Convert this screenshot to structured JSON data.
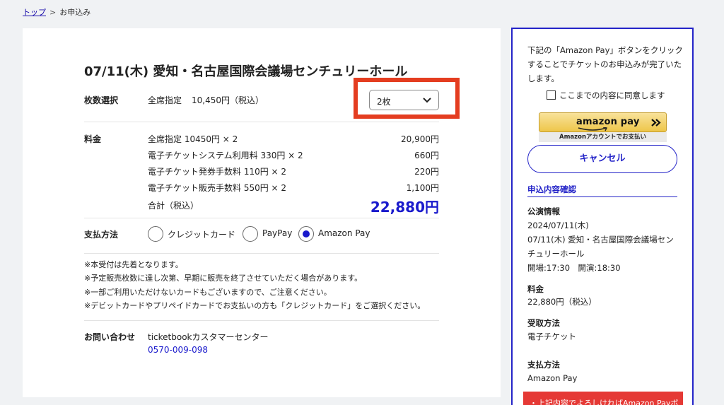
{
  "breadcrumb": {
    "home": "トップ",
    "separator": ">",
    "current": "お申込み"
  },
  "event": {
    "title": "07/11(木) 愛知・名古屋国際会議場センチュリーホール"
  },
  "quantity": {
    "label": "枚数選択",
    "seat_type": "全席指定",
    "unit_price": "10,450円（税込）",
    "selected": "2枚",
    "highlight_color": "#e43d20"
  },
  "fees": {
    "label": "料金",
    "lines": [
      {
        "desc": "全席指定 10450円 × 2",
        "amount": "20,900円"
      },
      {
        "desc": "電子チケットシステム利用料 330円 × 2",
        "amount": "660円"
      },
      {
        "desc": "電子チケット発券手数料 110円 × 2",
        "amount": "220円"
      },
      {
        "desc": "電子チケット販売手数料 550円 × 2",
        "amount": "1,100円"
      }
    ],
    "total_label": "合計（税込）",
    "total": "22,880円"
  },
  "payment": {
    "label": "支払方法",
    "options": [
      {
        "label": "クレジットカード",
        "selected": false
      },
      {
        "label": "PayPay",
        "selected": false
      },
      {
        "label": "Amazon Pay",
        "selected": true
      }
    ]
  },
  "notes": [
    "※本受付は先着となります。",
    "※予定販売枚数に達し次第、早期に販売を終了させていただく場合があります。",
    "※一部ご利用いただけないカードもございますので、ご注意ください。",
    "※デビットカードやプリペイドカードでお支払いの方も「クレジットカード」をご選択ください。"
  ],
  "contact": {
    "label": "お問い合わせ",
    "name": "ticketbookカスタマーセンター",
    "phone": "0570-009-098"
  },
  "sidebar": {
    "intro": "下記の「Amazon Pay」ボタンをクリックすることでチケットのお申込みが完了いたします。",
    "agree_label": "ここまでの内容に同意します",
    "amazon_pay": {
      "logo_text": "amazon pay",
      "sub_text": "Amazonアカウントでお支払い"
    },
    "cancel_label": "キャンセル",
    "confirm_heading": "申込内容確認",
    "performance": {
      "label": "公演情報",
      "date": "2024/07/11(木)",
      "venue_line1": "07/11(木) 愛知・名古屋国際会議場セン",
      "venue_line2": "チュリーホール",
      "times": "開場:17:30　開演:18:30"
    },
    "price": {
      "label": "料金",
      "value": "22,880円（税込）"
    },
    "receipt": {
      "label": "受取方法",
      "value": "電子チケット"
    },
    "pay_method": {
      "label": "支払方法",
      "value": "Amazon Pay"
    },
    "alert": "・上記内容でよろしければAmazon Payボ"
  },
  "colors": {
    "accent": "#2424c8",
    "alert": "#e53935"
  }
}
